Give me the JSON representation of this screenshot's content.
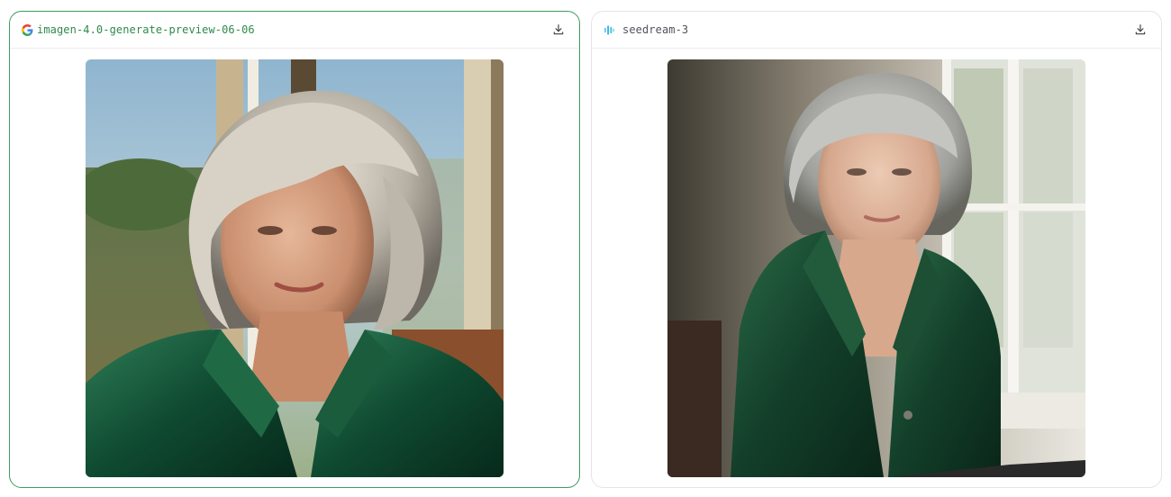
{
  "panels": [
    {
      "model_name": "imagen-4.0-generate-preview-06-06",
      "model_icon": "google-icon",
      "download_icon": "download-icon",
      "image_alt": "Portrait of a silver-haired woman in a green velvet blazer by a sunlit window",
      "accent": "#2f8a4c"
    },
    {
      "model_name": "seedream-3",
      "model_icon": "seedream-icon",
      "download_icon": "download-icon",
      "image_alt": "Portrait of a gray-haired woman in a green velvet jacket seated by a window",
      "accent": "#52525b"
    }
  ]
}
